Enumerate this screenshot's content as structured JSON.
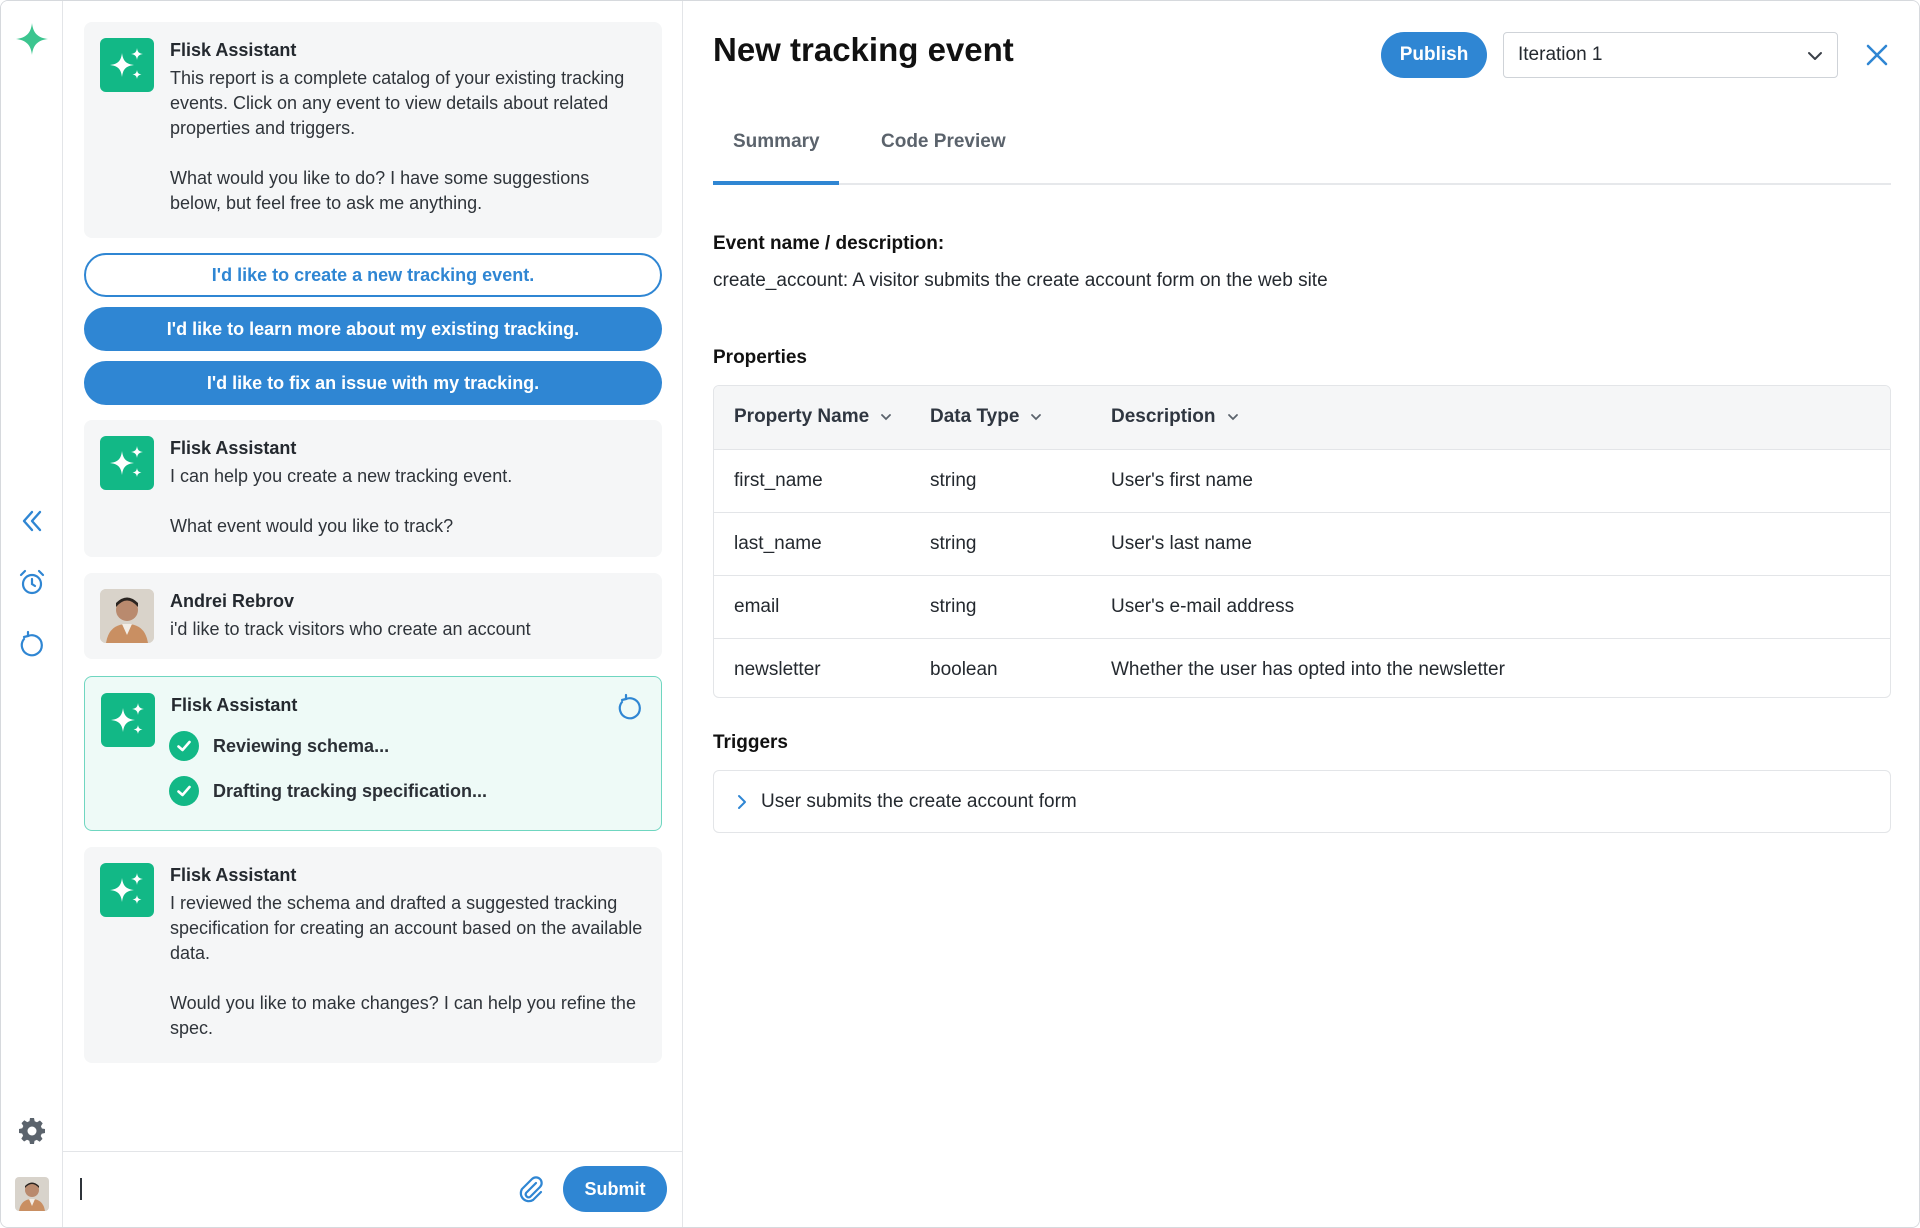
{
  "chat": {
    "messages": [
      {
        "sender": "Flisk Assistant",
        "text": "This report is a complete catalog of your existing tracking events. Click on any event to view details about related properties and triggers.\n\nWhat would you like to do? I have some suggestions below, but feel free to ask me anything."
      },
      {
        "sender": "Flisk Assistant",
        "text": "I can help you create a new tracking event.\n\nWhat event would you like to track?"
      },
      {
        "sender": "Andrei Rebrov",
        "text": "i'd like to track visitors who create an account"
      },
      {
        "sender": "Flisk Assistant",
        "steps": [
          "Reviewing schema...",
          "Drafting tracking specification..."
        ]
      },
      {
        "sender": "Flisk Assistant",
        "text": "I reviewed the schema and drafted a suggested tracking specification for creating an account based on the available data.\n\nWould you like to make changes? I can help you refine the spec."
      }
    ],
    "suggestions": [
      "I'd like to create a new tracking event.",
      "I'd like to learn more about my existing tracking.",
      "I'd like to fix an issue with my tracking."
    ],
    "composer": {
      "value": "",
      "submit_label": "Submit"
    }
  },
  "detail": {
    "title": "New tracking event",
    "publish_label": "Publish",
    "iteration_selected": "Iteration 1",
    "tabs": [
      "Summary",
      "Code Preview"
    ],
    "active_tab": "Summary",
    "event_label": "Event name / description:",
    "event_value": "create_account: A visitor submits the create account form on the web site",
    "properties_label": "Properties",
    "columns": [
      "Property Name",
      "Data Type",
      "Description"
    ],
    "rows": [
      [
        "first_name",
        "string",
        "User's first name"
      ],
      [
        "last_name",
        "string",
        "User's last name"
      ],
      [
        "email",
        "string",
        "User's e-mail address"
      ],
      [
        "newsletter",
        "boolean",
        "Whether the user has opted into the newsletter"
      ]
    ],
    "triggers_label": "Triggers",
    "triggers": [
      "User submits the create account form"
    ]
  },
  "colors": {
    "accent_blue": "#2f86d3",
    "assistant_green": "#12b886",
    "active_card_border": "#6fd6c0"
  }
}
